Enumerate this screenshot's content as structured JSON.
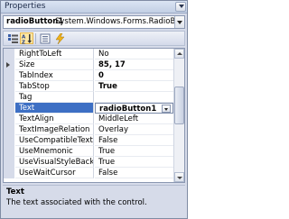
{
  "window": {
    "title": "Properties"
  },
  "selector": {
    "object_name": "radioButton1",
    "object_type": "System.Windows.Forms.RadioButton"
  },
  "toolbar": {
    "buttons": [
      {
        "name": "categorized-icon",
        "active": false
      },
      {
        "name": "alphabetical-icon",
        "active": true
      },
      {
        "name": "properties-icon",
        "active": false
      },
      {
        "name": "events-icon",
        "active": false
      }
    ]
  },
  "properties": [
    {
      "name": "RightToLeft",
      "value": "No",
      "bold": false,
      "expandable": false
    },
    {
      "name": "Size",
      "value": "85, 17",
      "bold": true,
      "expandable": true
    },
    {
      "name": "TabIndex",
      "value": "0",
      "bold": true,
      "expandable": false
    },
    {
      "name": "TabStop",
      "value": "True",
      "bold": true,
      "expandable": false
    },
    {
      "name": "Tag",
      "value": "",
      "bold": false,
      "expandable": false
    },
    {
      "name": "Text",
      "value": "radioButton1",
      "bold": true,
      "expandable": false,
      "selected": true
    },
    {
      "name": "TextAlign",
      "value": "MiddleLeft",
      "bold": false,
      "expandable": false
    },
    {
      "name": "TextImageRelation",
      "value": "Overlay",
      "bold": false,
      "expandable": false
    },
    {
      "name": "UseCompatibleTextRer",
      "value": "False",
      "bold": false,
      "expandable": false
    },
    {
      "name": "UseMnemonic",
      "value": "True",
      "bold": false,
      "expandable": false
    },
    {
      "name": "UseVisualStyleBackCol",
      "value": "True",
      "bold": false,
      "expandable": false
    },
    {
      "name": "UseWaitCursor",
      "value": "False",
      "bold": false,
      "expandable": false
    }
  ],
  "description": {
    "title": "Text",
    "text": "The text associated with the control."
  },
  "colors": {
    "selection": "#3d6fc4",
    "panel": "#d6dbe9"
  }
}
